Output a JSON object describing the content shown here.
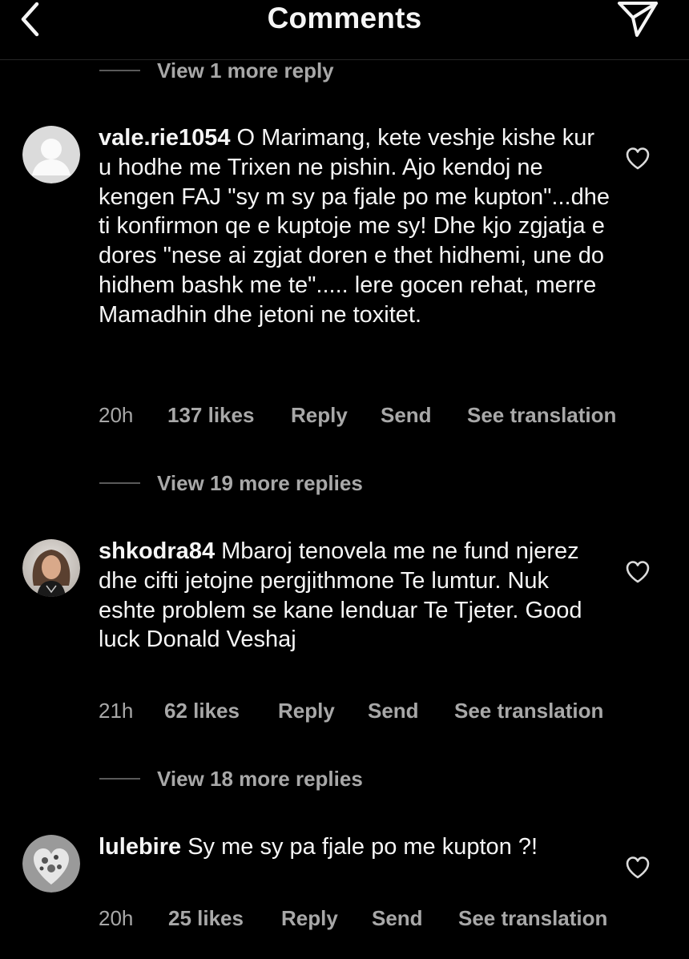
{
  "header": {
    "title": "Comments",
    "back_icon": "chevron-left-icon",
    "share_icon": "paper-plane-icon"
  },
  "top_view_replies": {
    "label": "View 1 more reply"
  },
  "comments": [
    {
      "username": "vale.rie1054",
      "text": "O Marimang, kete veshje kishe kur u hodhe me Trixen ne pishin. Ajo kendoj ne kengen FAJ \"sy m sy pa fjale po me kupton\"...dhe ti konfirmon qe e kuptoje me sy! Dhe kjo zgjatja e dores \"nese ai zgjat doren e thet hidhemi, une do hidhem bashk me te\"..... lere gocen rehat, merre Mamadhin dhe jetoni ne toxitet.",
      "time": "20h",
      "likes": "137 likes",
      "reply": "Reply",
      "send": "Send",
      "translate": "See translation",
      "view_replies": "View 19 more replies"
    },
    {
      "username": "shkodra84",
      "text": "Mbaroj tenovela me ne fund njerez dhe cifti jetojne pergjithmone Te lumtur. Nuk eshte problem se kane lenduar Te Tjeter. Good luck Donald Veshaj",
      "time": "21h",
      "likes": "62 likes",
      "reply": "Reply",
      "send": "Send",
      "translate": "See translation",
      "view_replies": "View 18 more replies"
    },
    {
      "username": "lulebire",
      "text": "Sy me sy pa fjale po me kupton ?!",
      "time": "20h",
      "likes": "25 likes",
      "reply": "Reply",
      "send": "Send",
      "translate": "See translation"
    }
  ],
  "colors": {
    "background": "#000000",
    "primary_text": "#f5f5f5",
    "secondary_text": "#a8a8a8"
  }
}
